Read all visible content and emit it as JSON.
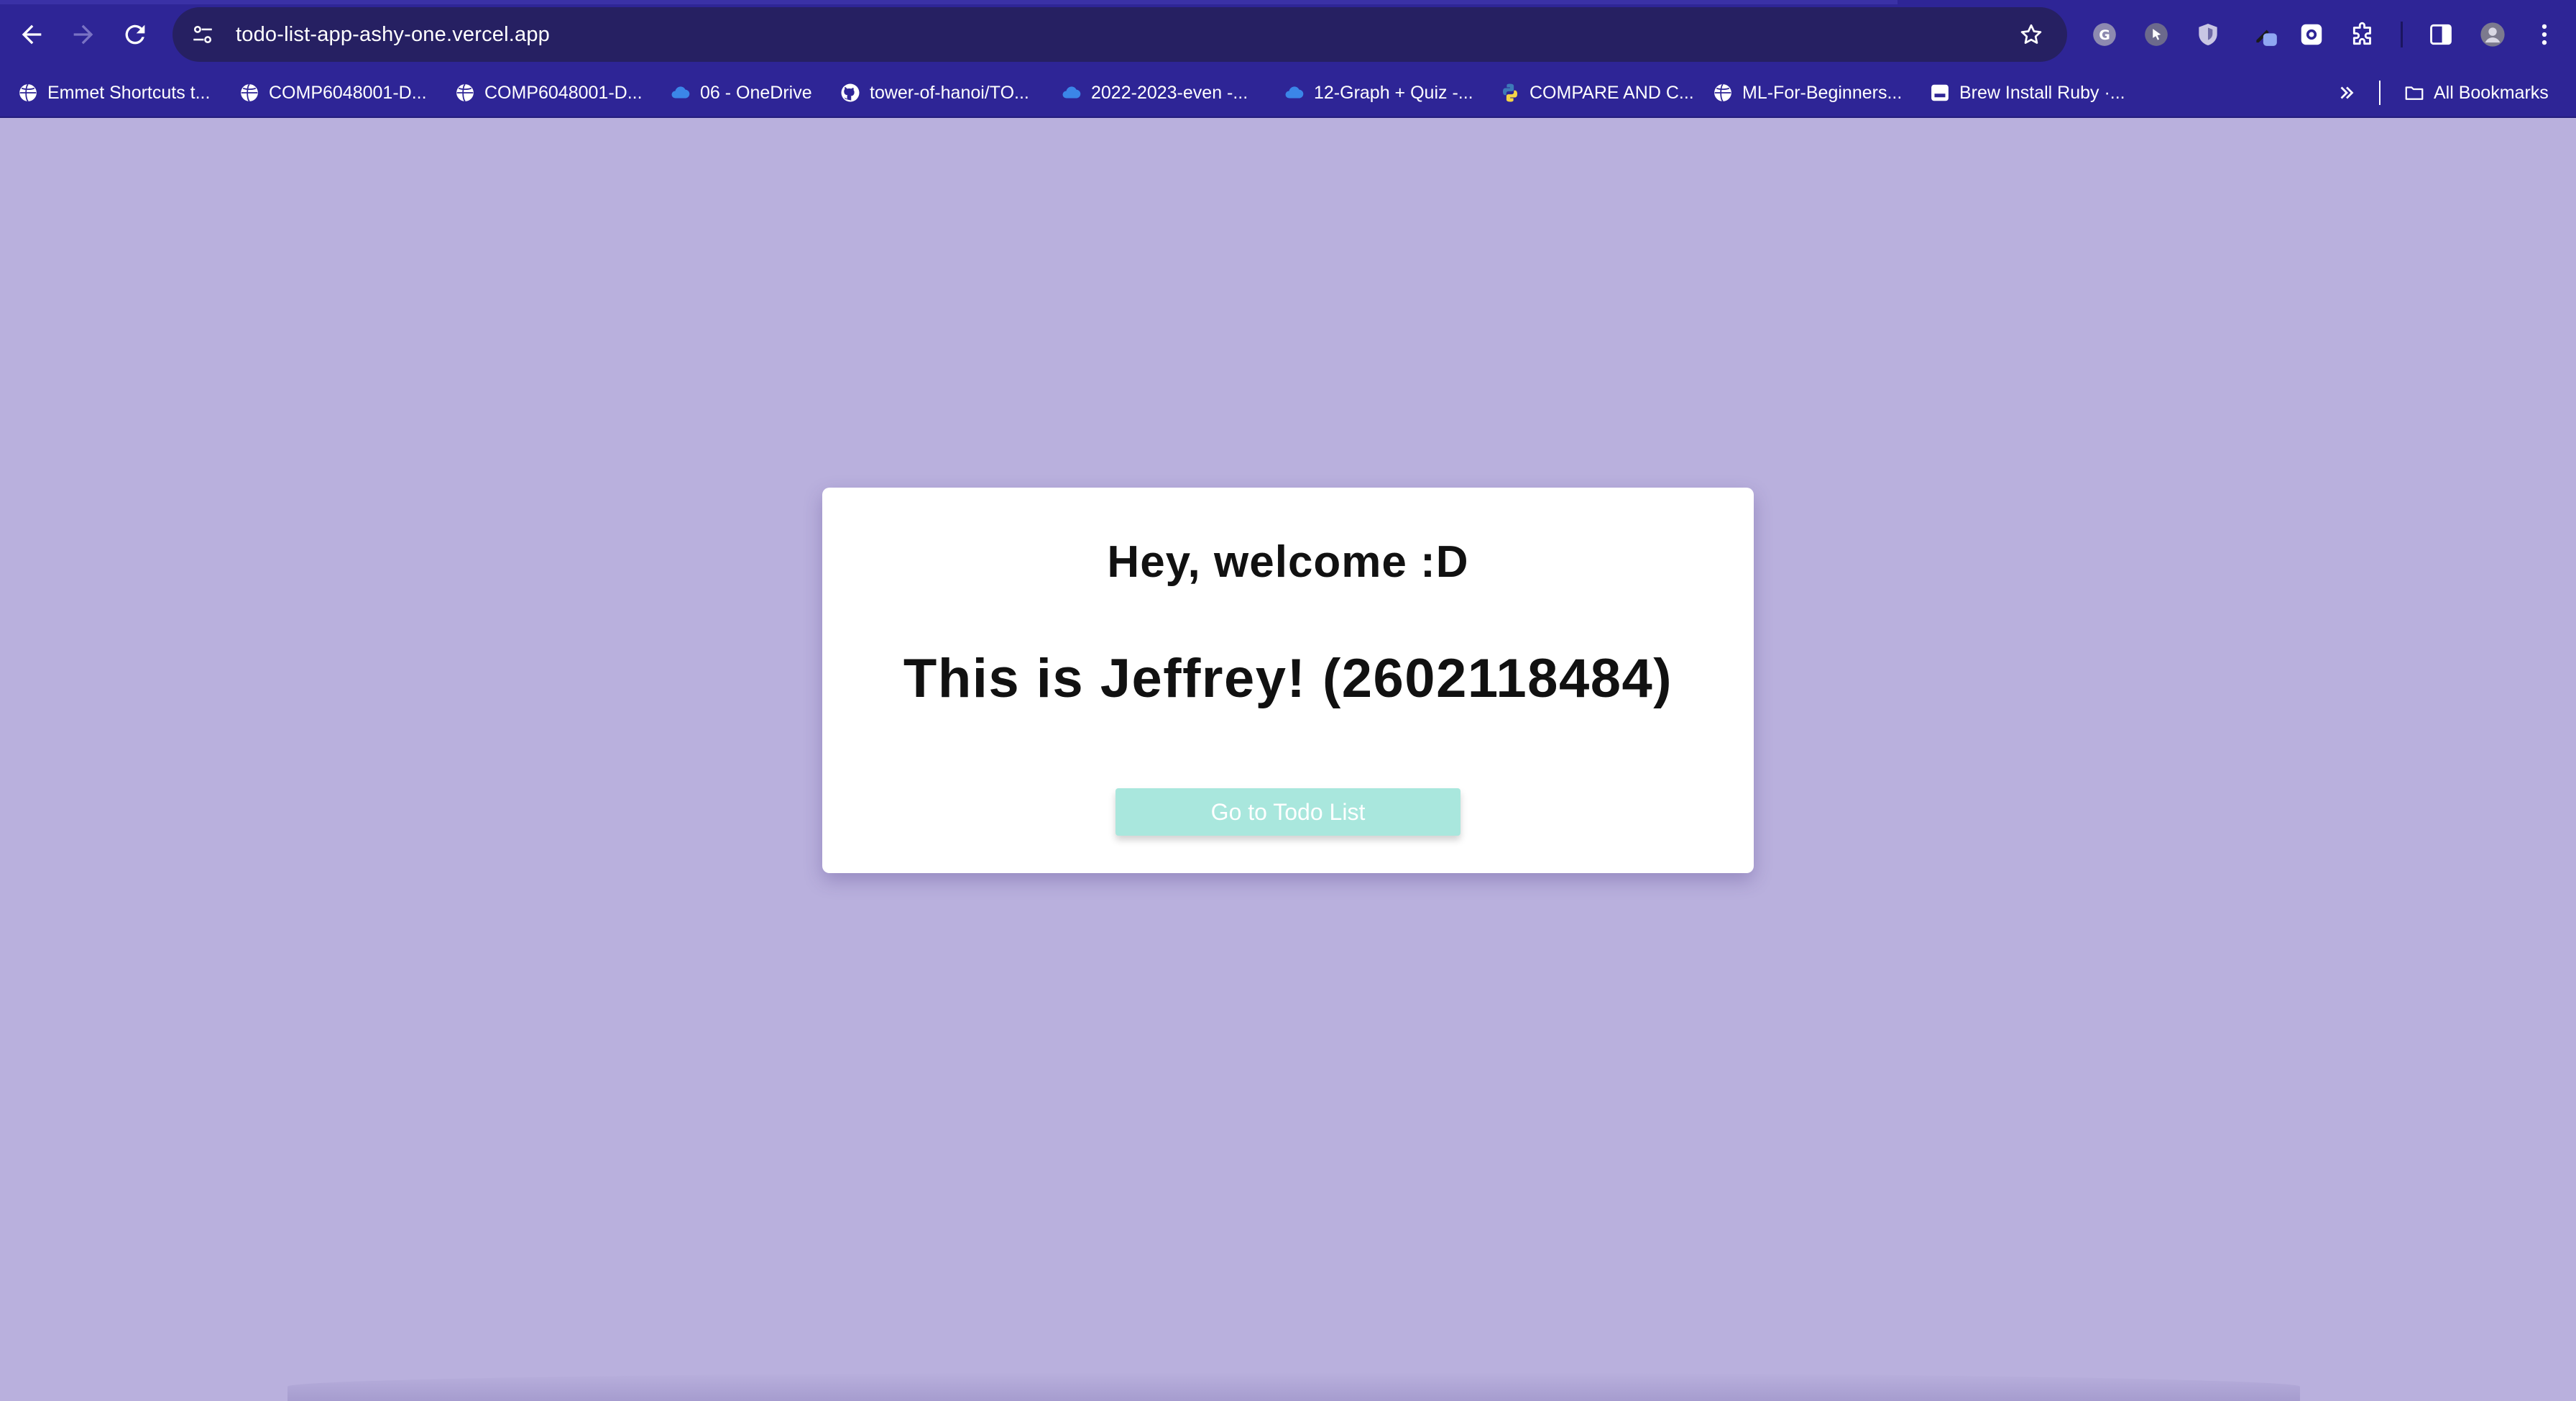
{
  "browser": {
    "url": "todo-list-app-ashy-one.vercel.app",
    "bookmarks": [
      {
        "label": "Emmet Shortcuts t...",
        "icon": "globe-icon"
      },
      {
        "label": "COMP6048001-D...",
        "icon": "globe-icon"
      },
      {
        "label": "COMP6048001-D...",
        "icon": "globe-icon"
      },
      {
        "label": "06 - OneDrive",
        "icon": "cloud-icon"
      },
      {
        "label": "tower-of-hanoi/TO...",
        "icon": "github-icon"
      },
      {
        "label": "2022-2023-even -...",
        "icon": "cloud-icon"
      },
      {
        "label": "12-Graph + Quiz -...",
        "icon": "cloud-icon"
      },
      {
        "label": "COMPARE AND C...",
        "icon": "python-icon"
      },
      {
        "label": "ML-For-Beginners...",
        "icon": "globe-icon"
      },
      {
        "label": "Brew Install Ruby ·...",
        "icon": "bookmark-page-icon"
      }
    ],
    "all_bookmarks_label": "All Bookmarks"
  },
  "card": {
    "greeting": "Hey, welcome :D",
    "intro": "This is Jeffrey! (2602118484)",
    "button_label": "Go to Todo List"
  },
  "colors": {
    "chrome": "#2e2596",
    "page_background": "#b9b0dd",
    "button": "#a9e7dd"
  }
}
